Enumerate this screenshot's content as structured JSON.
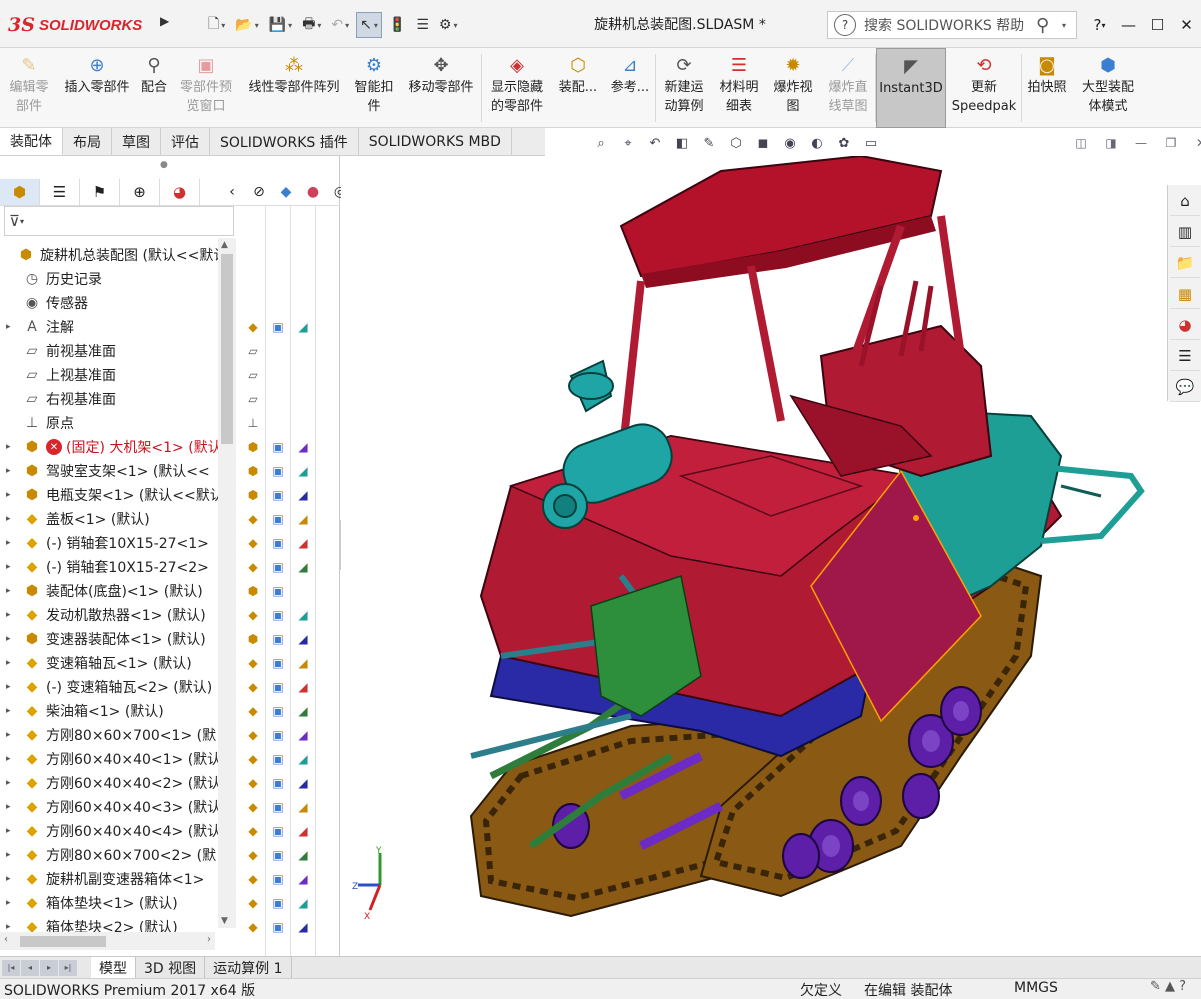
{
  "window": {
    "logo_ds": "3S",
    "logo_text": "SOLIDWORKS",
    "doc_title": "旋耕机总装配图.SLDASM *",
    "search_placeholder": "搜索 SOLIDWORKS 帮助",
    "help_label": "?",
    "minimize": "—",
    "maximize": "☐",
    "close": "✕"
  },
  "ribbon": [
    {
      "label": "编辑零\n部件",
      "icon": "edit-component-icon",
      "glyph": "✎",
      "enabled": false
    },
    {
      "label": "插入零部件",
      "icon": "insert-components-icon",
      "glyph": "⊕",
      "enabled": true
    },
    {
      "label": "配合",
      "icon": "mate-icon",
      "glyph": "⚲",
      "enabled": true
    },
    {
      "label": "零部件预\n览窗口",
      "icon": "component-preview-icon",
      "glyph": "▣",
      "enabled": false
    },
    {
      "label": "线性零部件阵列",
      "icon": "linear-pattern-icon",
      "glyph": "⁂",
      "enabled": true
    },
    {
      "label": "智能扣\n件",
      "icon": "smart-fasteners-icon",
      "glyph": "⚙",
      "enabled": true
    },
    {
      "label": "移动零部件",
      "icon": "move-component-icon",
      "glyph": "✥",
      "enabled": true
    },
    {
      "label": "显示隐藏\n的零部件",
      "icon": "show-hidden-icon",
      "glyph": "◈",
      "enabled": true
    },
    {
      "label": "装配...",
      "icon": "assembly-features-icon",
      "glyph": "⬡",
      "enabled": true
    },
    {
      "label": "参考...",
      "icon": "reference-geometry-icon",
      "glyph": "⊿",
      "enabled": true
    },
    {
      "label": "新建运\n动算例",
      "icon": "new-motion-study-icon",
      "glyph": "⟳",
      "enabled": true
    },
    {
      "label": "材料明\n细表",
      "icon": "bom-icon",
      "glyph": "☰",
      "enabled": true
    },
    {
      "label": "爆炸视\n图",
      "icon": "exploded-view-icon",
      "glyph": "✹",
      "enabled": true
    },
    {
      "label": "爆炸直\n线草图",
      "icon": "explode-line-sketch-icon",
      "glyph": "⟋",
      "enabled": false
    },
    {
      "label": "Instant3D",
      "icon": "instant3d-icon",
      "glyph": "◤",
      "enabled": true
    },
    {
      "label": "更新\nSpeedpak",
      "icon": "speedpak-icon",
      "glyph": "⟲",
      "enabled": true
    },
    {
      "label": "拍快照",
      "icon": "snapshot-icon",
      "glyph": "◙",
      "enabled": true
    },
    {
      "label": "大型装配\n体模式",
      "icon": "large-assembly-icon",
      "glyph": "⬢",
      "enabled": true
    }
  ],
  "command_tabs": [
    "装配体",
    "布局",
    "草图",
    "评估",
    "SOLIDWORKS 插件",
    "SOLIDWORKS MBD"
  ],
  "active_command_tab": "装配体",
  "tree": [
    {
      "label": "旋耕机总装配图 (默认<<默认",
      "icon": "assembly-icon",
      "glyph": "⬢",
      "expand": "",
      "indent": 0
    },
    {
      "label": "历史记录",
      "icon": "history-icon",
      "glyph": "◷",
      "expand": "",
      "indent": 1
    },
    {
      "label": "传感器",
      "icon": "sensor-icon",
      "glyph": "◉",
      "expand": "",
      "indent": 1
    },
    {
      "label": "注解",
      "icon": "annotation-icon",
      "glyph": "A",
      "expand": "▸",
      "indent": 1
    },
    {
      "label": "前视基准面",
      "icon": "plane-icon",
      "glyph": "▱",
      "expand": "",
      "indent": 1
    },
    {
      "label": "上视基准面",
      "icon": "plane-icon",
      "glyph": "▱",
      "expand": "",
      "indent": 1
    },
    {
      "label": "右视基准面",
      "icon": "plane-icon",
      "glyph": "▱",
      "expand": "",
      "indent": 1
    },
    {
      "label": "原点",
      "icon": "origin-icon",
      "glyph": "⊥",
      "expand": "",
      "indent": 1
    },
    {
      "label": "(固定) 大机架<1> (默认",
      "icon": "subassembly-icon",
      "glyph": "⬢",
      "expand": "▸",
      "indent": 1,
      "error": true
    },
    {
      "label": "驾驶室支架<1> (默认<<",
      "icon": "subassembly-icon",
      "glyph": "⬢",
      "expand": "▸",
      "indent": 1
    },
    {
      "label": "电瓶支架<1> (默认<<默认",
      "icon": "subassembly-icon",
      "glyph": "⬢",
      "expand": "▸",
      "indent": 1
    },
    {
      "label": "盖板<1> (默认)",
      "icon": "part-icon",
      "glyph": "◆",
      "expand": "▸",
      "indent": 1
    },
    {
      "label": "(-) 销轴套10X15-27<1>",
      "icon": "part-icon",
      "glyph": "◆",
      "expand": "▸",
      "indent": 1
    },
    {
      "label": "(-) 销轴套10X15-27<2>",
      "icon": "part-icon",
      "glyph": "◆",
      "expand": "▸",
      "indent": 1
    },
    {
      "label": "装配体(底盘)<1> (默认)",
      "icon": "subassembly-icon",
      "glyph": "⬢",
      "expand": "▸",
      "indent": 1
    },
    {
      "label": "发动机散热器<1> (默认)",
      "icon": "part-icon",
      "glyph": "◆",
      "expand": "▸",
      "indent": 1
    },
    {
      "label": "变速器装配体<1> (默认)",
      "icon": "subassembly-icon",
      "glyph": "⬢",
      "expand": "▸",
      "indent": 1
    },
    {
      "label": "变速箱轴瓦<1> (默认)",
      "icon": "part-icon",
      "glyph": "◆",
      "expand": "▸",
      "indent": 1
    },
    {
      "label": "(-) 变速箱轴瓦<2> (默认)",
      "icon": "part-icon",
      "glyph": "◆",
      "expand": "▸",
      "indent": 1
    },
    {
      "label": "柴油箱<1> (默认)",
      "icon": "part-icon",
      "glyph": "◆",
      "expand": "▸",
      "indent": 1
    },
    {
      "label": "方刚80×60×700<1> (默",
      "icon": "part-icon",
      "glyph": "◆",
      "expand": "▸",
      "indent": 1
    },
    {
      "label": "方刚60×40×40<1> (默认",
      "icon": "part-icon",
      "glyph": "◆",
      "expand": "▸",
      "indent": 1
    },
    {
      "label": "方刚60×40×40<2> (默认",
      "icon": "part-icon",
      "glyph": "◆",
      "expand": "▸",
      "indent": 1
    },
    {
      "label": "方刚60×40×40<3> (默认",
      "icon": "part-icon",
      "glyph": "◆",
      "expand": "▸",
      "indent": 1
    },
    {
      "label": "方刚60×40×40<4> (默认",
      "icon": "part-icon",
      "glyph": "◆",
      "expand": "▸",
      "indent": 1
    },
    {
      "label": "方刚80×60×700<2> (默",
      "icon": "part-icon",
      "glyph": "◆",
      "expand": "▸",
      "indent": 1
    },
    {
      "label": "旋耕机副变速器箱体<1>",
      "icon": "part-icon",
      "glyph": "◆",
      "expand": "▸",
      "indent": 1
    },
    {
      "label": "箱体垫块<1> (默认)",
      "icon": "part-icon",
      "glyph": "◆",
      "expand": "▸",
      "indent": 1
    },
    {
      "label": "箱体垫块<2> (默认)",
      "icon": "part-icon",
      "glyph": "◆",
      "expand": "▸",
      "indent": 1
    }
  ],
  "bottom_tabs": [
    "模型",
    "3D 视图",
    "运动算例 1"
  ],
  "active_bottom_tab": "模型",
  "status": {
    "app": "SOLIDWORKS Premium 2017 x64 版",
    "definition": "欠定义",
    "editing": "在编辑 装配体",
    "units": "MMGS"
  },
  "colors": {
    "brand": "#d8262d",
    "canopy": "#b3122a",
    "body": "#b01a33",
    "teal": "#1e9f96",
    "track": "#8a5a14",
    "wheels": "#5d1ea8",
    "blue": "#2a2aa6",
    "green": "#2f7d3a"
  }
}
